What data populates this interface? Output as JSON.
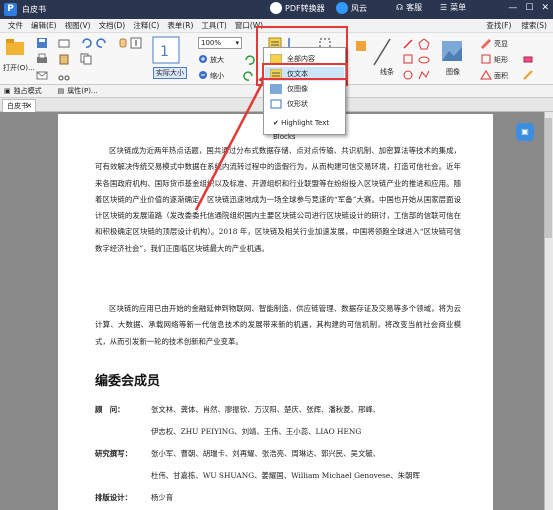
{
  "titlebar": {
    "app_name": "白皮书",
    "pdf_converter": "PDF转换器",
    "fengyun": "风云",
    "kefu": "客服",
    "caidan": "菜单"
  },
  "menu": [
    "文件",
    "编辑(E)",
    "视图(V)",
    "文档(D)",
    "注释(C)",
    "表单(R)",
    "工具(T)",
    "窗口(W)"
  ],
  "menu_right": [
    "查找(F)",
    "搜索(S)"
  ],
  "ribbon": {
    "open": "打开(O)...",
    "actual_size": "实际大小",
    "zoom_value": "100%",
    "zoom_in": "放大",
    "zoom_out": "缩小",
    "line": "线条",
    "image": "图像",
    "highlight": "亮显",
    "rectangle": "矩形",
    "area": "面积"
  },
  "subbar": {
    "standalone_mode": "独占模式",
    "properties": "属性(P)..."
  },
  "tab": {
    "label": "白皮书"
  },
  "dropdown": {
    "items": [
      "全部内容",
      "仅文本",
      "仅图像",
      "仅形状",
      "Highlight Text Blocks"
    ],
    "selected": "仅文本",
    "checked": "Highlight Text Blocks"
  },
  "document": {
    "paragraph1": "区块链成为近两年热点话题，国共通过分布式数据存储、点对点传输、共识机制、加密算法等技术的集成，可有效解决传统交易模式中数据在系统内流转过程中的造假行为，从而构建可信交易环境，打造可信社会。近年来各国政府机构、国际货币基金组织以及标准、开源组织和行业联盟等在纷纷投入区块链产业的推进和应用。随着区块链的产业价值的逐渐确定，区块链迅速地成为一场全球参与竞速的“军备”大赛。中国也开始从国家层面设计区块链的发展道路（发改委委托信通院组织国内主要区块链公司进行区块链设计的研讨，工信部的信联可信在和积极确定区块链的顶层设计机构）。2018 年，区块链及相关行业加速发展，中国将领跑全球进入“区块链可信数字经济社会”，我们正面临区块链最大的产业机遇。",
    "paragraph2": "区块链的应用已由开始的金融延伸到物联网、智能制造、供应链管理、数据存证及交易等多个领域，将为云计算、大数据、承载网络等新一代信息技术的发展带来新的机遇，其构建的可信机制，将改变当前社会商业模式，从而引发新一轮的技术创新和产业变革。",
    "heading": "编委会成员",
    "members": [
      {
        "role": "顾　问：",
        "names": "张文林、龚体、肖然、廖振钦、万汉阳、楚庆、张辉、潘秋菱、邢峰、"
      },
      {
        "role": "",
        "names": "伊志权、ZHU PEIYING、刘靖、王伟、王小蕊、LIAO HENG"
      },
      {
        "role": "研究撰写：",
        "names": "张小军、曹朝、胡瑞卡、刘再耀、张浩亮、周琳达、郭兴民、吴文毓、"
      },
      {
        "role": "",
        "names": "杜伟、甘嘉栋、WU SHUANG、姜耀国、William Michael Genovese、朱朝晖"
      },
      {
        "role": "排版设计：",
        "names": "杨少育"
      }
    ]
  },
  "colors": {
    "titlebar": "#2a3550",
    "highlight_red": "#e53935",
    "viewer_bg": "#8a8a8a",
    "accent": "#2f7be0"
  }
}
